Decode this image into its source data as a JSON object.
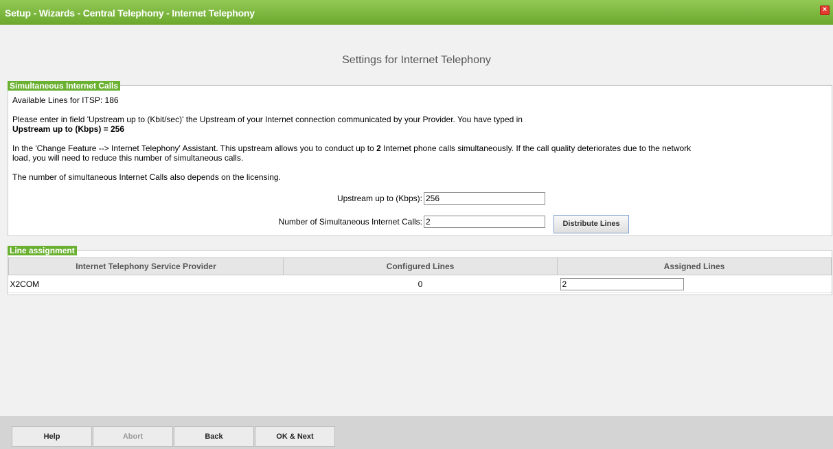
{
  "window": {
    "title": "Setup - Wizards - Central Telephony - Internet Telephony",
    "close_symbol": "×"
  },
  "page": {
    "heading": "Settings for Internet Telephony"
  },
  "simultaneous": {
    "legend": "Simultaneous Internet Calls",
    "available_lines": "Available Lines for ITSP: 186",
    "intro": "Please enter in field 'Upstream up to (Kbit/sec)' the Upstream of your Internet connection communicated by your Provider. You have typed in",
    "typed_value": "Upstream up to (Kbps) = 256",
    "para_line1_a": "In the 'Change Feature --> Internet Telephony' Assistant. This upstream allows you to conduct up to ",
    "para_line1_b": "2",
    "para_line1_c": " Internet phone calls simultaneously. If the call quality deteriorates due to the network",
    "para_line2": "load, you will need to reduce this number of simultaneous calls.",
    "licensing_note": "The number of simultaneous Internet Calls also depends on the licensing.",
    "upstream_label": "Upstream up to (Kbps):",
    "upstream_value": "256",
    "calls_label": "Number of Simultaneous Internet Calls:",
    "calls_value": "2",
    "distribute_button": "Distribute Lines"
  },
  "line_assignment": {
    "legend": "Line assignment",
    "columns": [
      "Internet Telephony Service Provider",
      "Configured Lines",
      "Assigned Lines"
    ],
    "rows": [
      {
        "provider": "X2COM",
        "configured": "0",
        "assigned": "2"
      }
    ]
  },
  "footer": {
    "help": "Help",
    "abort": "Abort",
    "back": "Back",
    "ok_next": "OK & Next"
  },
  "colors": {
    "title_bar": "#7ab840",
    "legend": "#6bb131",
    "close": "#e23b2e"
  }
}
